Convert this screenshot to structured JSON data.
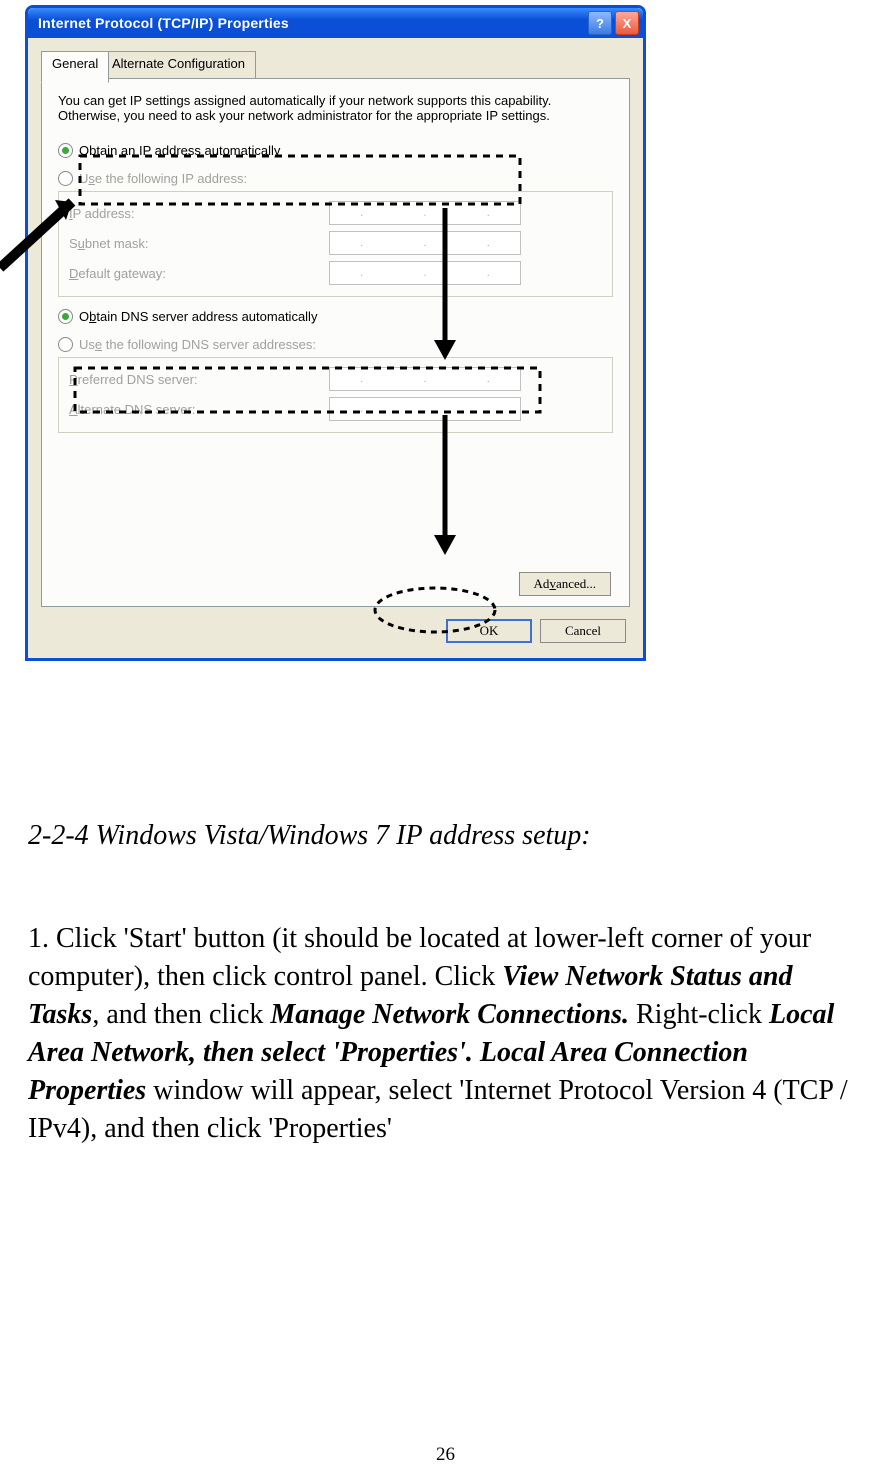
{
  "dialog": {
    "title": "Internet Protocol (TCP/IP) Properties",
    "tabs": {
      "general": "General",
      "alt": "Alternate Configuration"
    },
    "intro": "You can get IP settings assigned automatically if your network supports this capability. Otherwise, you need to ask your network administrator for the appropriate IP settings.",
    "radios": {
      "obtain_ip": "Obtain an IP address automatically",
      "use_ip": "Use the following IP address:",
      "obtain_dns": "Obtain DNS server address automatically",
      "use_dns": "Use the following DNS server addresses:"
    },
    "labels": {
      "ip": "IP address:",
      "subnet": "Subnet mask:",
      "gateway": "Default gateway:",
      "pdns": "Preferred DNS server:",
      "adns": "Alternate DNS server:"
    },
    "buttons": {
      "advanced": "Advanced...",
      "ok": "OK",
      "cancel": "Cancel",
      "help": "?",
      "close": "X"
    }
  },
  "doc": {
    "heading": "2-2-4 Windows Vista/Windows 7 IP address setup:",
    "p1a": "1. Click 'Start' button (it should be located at lower-left corner of your computer), then click control panel. Click ",
    "p1b": "View Network Status and Tasks",
    "p1c": ", and then click ",
    "p1d": "Manage Network Connections.",
    "p1e": " Right-click ",
    "p1f": "Local Area Network, then select 'Properties'. Local Area Connection Properties",
    "p1g": " window will appear, select 'Internet Protocol Version 4 (TCP / IPv4), and then click 'Properties'",
    "pagenum": "26"
  }
}
